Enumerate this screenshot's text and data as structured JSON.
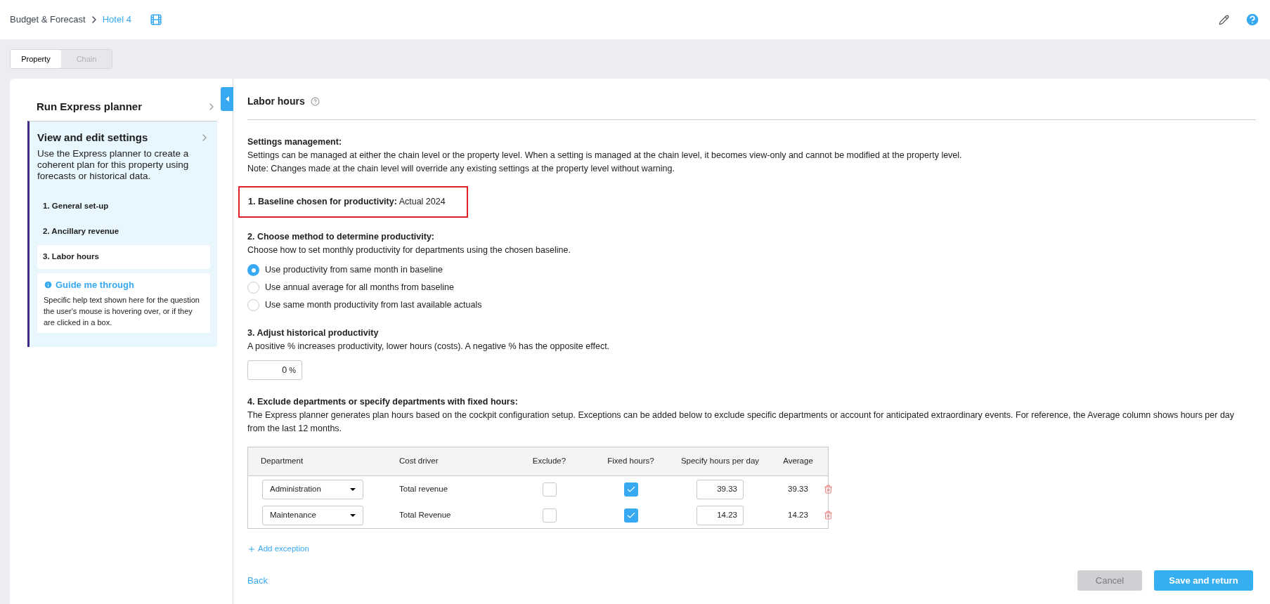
{
  "breadcrumb": {
    "root": "Budget & Forecast",
    "current": "Hotel 4"
  },
  "tabs": [
    {
      "label": "Property",
      "selected": true
    },
    {
      "label": "Chain",
      "selected": false
    }
  ],
  "sidebar": {
    "items": [
      {
        "title": "Run Express planner",
        "expanded": false
      },
      {
        "title": "View and edit settings",
        "expanded": true,
        "description": "Use the Express planner to create a coherent plan for this property using forecasts or historical data.",
        "steps": [
          {
            "label": "1. General set-up",
            "selected": false
          },
          {
            "label": "2. Ancillary revenue",
            "selected": false
          },
          {
            "label": "3. Labor hours",
            "selected": true
          }
        ]
      }
    ],
    "guide": {
      "title": "Guide me through",
      "text": "Specific help text shown here for the question the user's mouse is hovering over, or if they are clicked in a box."
    }
  },
  "main": {
    "title": "Labor hours",
    "settings_heading": "Settings management:",
    "settings_lines": [
      "Settings can be managed at either the chain level or the property level. When a setting is managed at the chain level, it becomes view-only and cannot be modified at the property level.",
      "Note: Changes made at the chain level will override any existing settings at the property level without warning."
    ],
    "baseline": "**1.  Baseline chosen for productivity:** Actual 2024",
    "method": {
      "heading": "2.  Choose method to determine productivity:",
      "text": "Choose how to set monthly productivity for departments using the chosen baseline.",
      "options": [
        {
          "label": "Use productivity from same month in baseline",
          "selected": true
        },
        {
          "label": "Use annual average for all months from baseline",
          "selected": false
        },
        {
          "label": "Use same month productivity from last available actuals",
          "selected": false
        }
      ]
    },
    "adjust": {
      "heading": "3.  Adjust historical productivity",
      "text": "A positive % increases productivity, lower hours (costs). A negative % has the opposite effect.",
      "value": "0",
      "unit": "%"
    },
    "exclude": {
      "heading": "4.  Exclude departments or specify departments with fixed hours:",
      "text": "The Express planner generates plan hours based on the cockpit configuration setup. Exceptions can be added below to exclude specific departments or account for anticipated extraordinary events. For reference, the Average column shows hours per day from the last 12 months."
    },
    "table": {
      "columns": [
        "Department",
        "Cost driver",
        "Exclude?",
        "Fixed hours?",
        "Specify hours per day",
        "Average"
      ],
      "rows": [
        {
          "department": "Administration",
          "cost_driver": "Total revenue",
          "exclude": false,
          "fixed": true,
          "hours": "39.33",
          "average": "39.33"
        },
        {
          "department": "Maintenance",
          "cost_driver": "Total Revenue",
          "exclude": false,
          "fixed": true,
          "hours": "14.23",
          "average": "14.23"
        }
      ]
    },
    "add_exception": "Add exception",
    "back": "Back",
    "cancel": {
      "label": "Cancel",
      "disabled": true
    },
    "save": "Save and return"
  }
}
